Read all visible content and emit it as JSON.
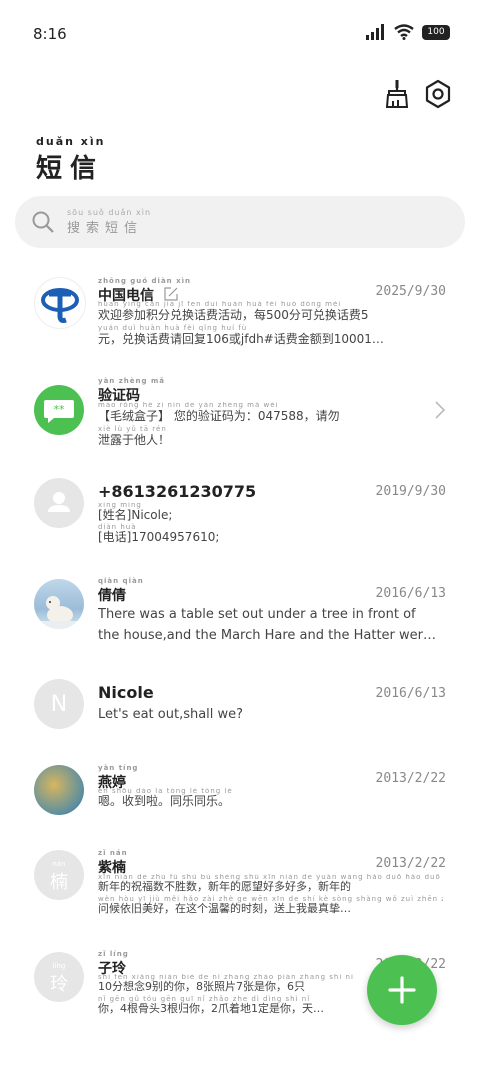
{
  "status": {
    "time": "8:16",
    "battery": "100"
  },
  "title": {
    "pinyin": "duǎn xìn",
    "text": "短信"
  },
  "search": {
    "pinyin": "sōu suǒ duǎn xìn",
    "placeholder": "搜索短信"
  },
  "messages": [
    {
      "name": "中国电信",
      "name_pinyin": "zhōng guó diàn xìn",
      "date": "2025/9/30",
      "line1_pinyin": "huān yíng cān jiā jī fēn duì huàn huà fèi huó dòng měi",
      "line1": "欢迎参加积分兑换话费活动，每500分可兑换话费5",
      "line2_pinyin": "yuán duì huàn huà fèi qǐng huí fù",
      "line2": "元，兑换话费请回复106或jfdh#话费金额到10001…"
    },
    {
      "name": "验证码",
      "name_pinyin": "yàn zhèng mǎ",
      "date": "",
      "line1_pinyin": "máo róng hé zi nín de yàn zhèng mǎ wéi",
      "line1": "【毛绒盒子】 您的验证码为：047588，请勿",
      "line2_pinyin": "xiè lù yǔ tā rén",
      "line2": "泄露于他人！"
    },
    {
      "name": "+8613261230775",
      "name_pinyin": "",
      "date": "2019/9/30",
      "line1_pinyin": "xìng míng",
      "line1": "[姓名]Nicole;",
      "line2_pinyin": "diàn huà",
      "line2": "[电话]17004957610;"
    },
    {
      "name": "倩倩",
      "name_pinyin": "qiàn qiàn",
      "date": "2016/6/13",
      "line1_pinyin": "",
      "line1": "There was a table set out under a tree in front of",
      "line2_pinyin": "",
      "line2": "the house,and the March Hare and the Hatter wer…"
    },
    {
      "name": "Nicole",
      "name_pinyin": "",
      "date": "2016/6/13",
      "line1_pinyin": "",
      "line1": "Let's eat out,shall we?",
      "line2_pinyin": "",
      "line2": ""
    },
    {
      "name": "燕婷",
      "name_pinyin": "yàn tíng",
      "date": "2013/2/22",
      "line1_pinyin": "èn shōu dào lā tóng lè tóng lè",
      "line1": "嗯。收到啦。同乐同乐。",
      "line2_pinyin": "",
      "line2": ""
    },
    {
      "name": "紫楠",
      "name_pinyin": "zǐ nán",
      "date": "2013/2/22",
      "line1_pinyin": "xīn nián de zhù fú shù bú shèng shù xīn nián de yuàn wàng hǎo duō hǎo duō",
      "line1": "新年的祝福数不胜数，新年的愿望好多好多，新年的",
      "line2_pinyin": "wèn hòu yī jiù měi hǎo zài zhè ge wēn xīn de shí kè sòng shàng wǒ zuì zhēn zhì",
      "line2": "问候依旧美好，在这个温馨的时刻，送上我最真挚…"
    },
    {
      "name": "子玲",
      "name_pinyin": "zǐ líng",
      "date": "2013/2/22",
      "line1_pinyin": "shí fēn xiǎng niàn bié de nǐ zhāng zhào piàn zhāng shì nǐ",
      "line1": "10分想念9别的你，8张照片7张是你，6只",
      "line2_pinyin": "nǐ gēn gǔ tóu gēn guī nǐ zhǎo zhe dì dìng shì nǐ",
      "line2": "你，4根骨头3根归你，2爪着地1定是你，天…"
    }
  ],
  "avatars": {
    "nicole_letter": "N",
    "zinan_char": "楠",
    "zinan_pinyin": "nán",
    "ziling_char": "玲",
    "ziling_pinyin": "líng",
    "sms_text": "**"
  },
  "colors": {
    "accent": "#4cc152",
    "telecom_blue": "#1d5fb4"
  }
}
